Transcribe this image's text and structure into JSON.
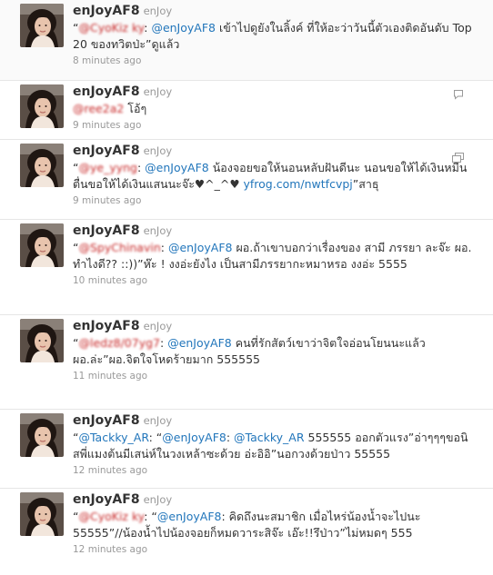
{
  "tweets": [
    {
      "username": "enJoyAF8",
      "fullname": "enJoy",
      "time": "8 minutes ago",
      "p": [
        "“",
        "@CyoKiz ky",
        ": ",
        "@enJoyAF8",
        " เข้าไปดูยังในลิ้งค์ ที่ให้อะว่าวันนี้ตัวเองติดอันดับ Top 20 ของทวิตป่ะ”ดูแล้ว"
      ]
    },
    {
      "username": "enJoyAF8",
      "fullname": "enJoy",
      "time": "9 minutes ago",
      "p": [
        "@ree2a2",
        " โอ้ๆ"
      ],
      "icon": "reply-icon"
    },
    {
      "username": "enJoyAF8",
      "fullname": "enJoy",
      "time": "9 minutes ago",
      "p": [
        "“",
        "@ye_yyng",
        ": ",
        "@enJoyAF8",
        " น้องจอยขอให้นอนหลับฝันดีนะ นอนขอให้ได้เงินหมื่นตื่นขอให้ได้เงินแสนนะจ๊ะ♥^_^♥ ",
        "yfrog.com/nwtfcvpj",
        "”สาธุ"
      ],
      "icon": "media-icon"
    },
    {
      "username": "enJoyAF8",
      "fullname": "enJoy",
      "time": "10 minutes ago",
      "p": [
        "“",
        "@SpyChinavin",
        ": ",
        "@enJoyAF8",
        " ผอ.ถ้าเขาบอกว่าเรื่องของ สามี ภรรยา ละจ๊ะ ผอ. ทำไงดี?? ::))”ห๊ะ ! งงอ่ะยังไง เป็นสามีภรรยากะหมาหรอ งงอ่ะ 5555"
      ]
    },
    {
      "username": "enJoyAF8",
      "fullname": "enJoy",
      "time": "11 minutes ago",
      "p": [
        "“",
        "@ledz8/07yg7",
        ": ",
        "@enJoyAF8",
        " คนที่รักสัตว์เขาว่าจิตใจอ่อนโยนนะแล้วผอ.ล่ะ”ผอ.จิตใจโหดร้ายมาก 555555"
      ]
    },
    {
      "username": "enJoyAF8",
      "fullname": "enJoy",
      "time": "12 minutes ago",
      "p": [
        "“",
        "@Tackky_AR",
        ": “",
        "@enJoyAF8",
        ": ",
        "@Tackky_AR",
        " 555555 ออกตัวแรง”อ่าๆๆๆขอนิสพี่แมงต้นมีเสน่ห์ในวงเหล้าซะด้วย อ่ะอิอิ”นอกวงด้วยป่าว 55555"
      ]
    },
    {
      "username": "enJoyAF8",
      "fullname": "enJoy",
      "time": "12 minutes ago",
      "p": [
        "“",
        "@CyoKiz ky",
        ": “",
        "@enJoyAF8",
        ": คิดถึงนะสมาชิก เมื่อไหร่น้องน้ำจะไปนะ 55555”//น้องน้ำไปน้องจอยก็หมดวาระสิจ๊ะ เอ๊ะ!!รึป่าว”ไม่หมดๆ 555"
      ]
    }
  ],
  "colors": {
    "mention": "#2276bb",
    "redacted": "#c82828",
    "meta": "#999999"
  }
}
